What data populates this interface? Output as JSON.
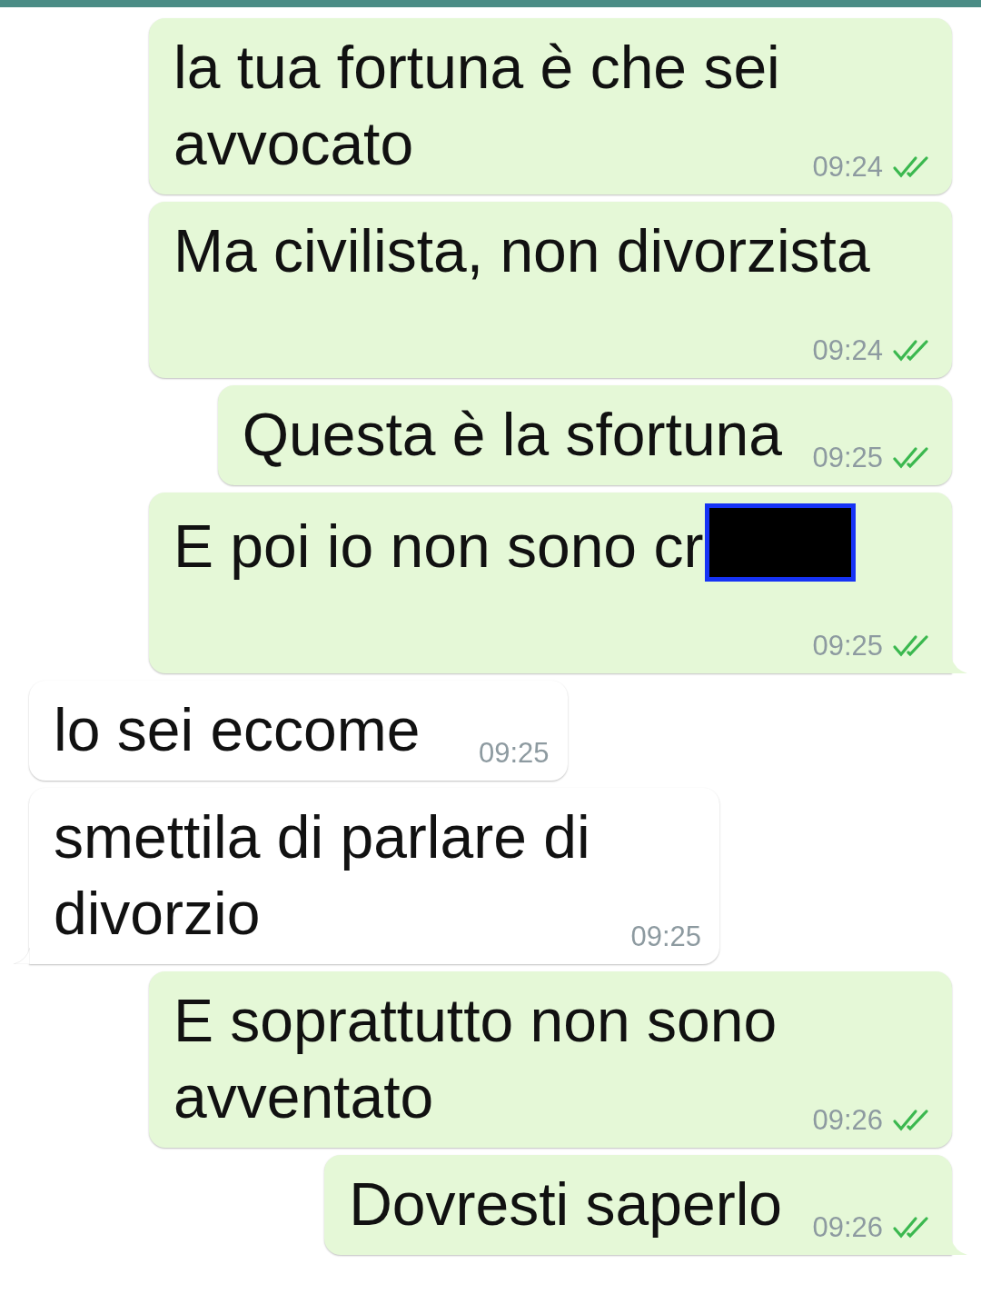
{
  "messages": [
    {
      "kind": "outgoing",
      "text": "la tua fortuna è che sei avvocato",
      "time": "09:24",
      "read": true,
      "tail": false,
      "redacted": false
    },
    {
      "kind": "outgoing",
      "text": "Ma civilista, non divorzista",
      "time": "09:24",
      "read": true,
      "tail": false,
      "redacted": false
    },
    {
      "kind": "outgoing",
      "text": "Questa è la sfortuna",
      "time": "09:25",
      "read": true,
      "tail": false,
      "redacted": false
    },
    {
      "kind": "outgoing",
      "text": "E poi io non sono cr",
      "time": "09:25",
      "read": true,
      "tail": true,
      "redacted": true
    },
    {
      "kind": "incoming",
      "text": "lo sei eccome",
      "time": "09:25",
      "tail": false,
      "redacted": false
    },
    {
      "kind": "incoming",
      "text": "smettila di parlare di divorzio",
      "time": "09:25",
      "tail": true,
      "redacted": false
    },
    {
      "kind": "outgoing",
      "text": "E soprattutto non sono avventato",
      "time": "09:26",
      "read": true,
      "tail": false,
      "redacted": false
    },
    {
      "kind": "outgoing",
      "text": "Dovresti saperlo",
      "time": "09:26",
      "read": true,
      "tail": true,
      "redacted": false
    }
  ]
}
